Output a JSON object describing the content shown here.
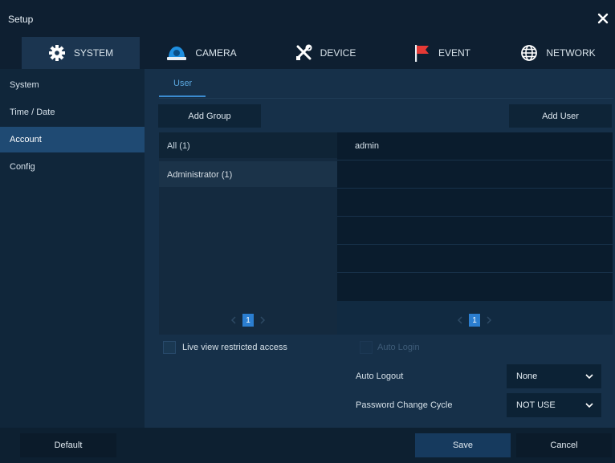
{
  "window": {
    "title": "Setup",
    "close_icon": "close-icon"
  },
  "tabs": [
    {
      "label": "SYSTEM",
      "icon": "gear-icon",
      "active": true
    },
    {
      "label": "CAMERA",
      "icon": "camera-icon",
      "active": false
    },
    {
      "label": "DEVICE",
      "icon": "tools-icon",
      "active": false
    },
    {
      "label": "EVENT",
      "icon": "flag-icon",
      "active": false
    },
    {
      "label": "NETWORK",
      "icon": "globe-icon",
      "active": false
    }
  ],
  "sidebar": {
    "items": [
      {
        "label": "System",
        "active": false
      },
      {
        "label": "Time / Date",
        "active": false
      },
      {
        "label": "Account",
        "active": true
      },
      {
        "label": "Config",
        "active": false
      }
    ]
  },
  "main": {
    "subtab": "User",
    "add_group": "Add Group",
    "add_user": "Add User",
    "groups": [
      "All (1)",
      "Administrator (1)"
    ],
    "users": [
      "admin",
      "",
      "",
      "",
      "",
      ""
    ],
    "group_page": "1",
    "user_page": "1",
    "live_view_label": "Live view restricted access",
    "auto_login_label": "Auto Login",
    "auto_logout_label": "Auto Logout",
    "auto_logout_value": "None",
    "password_cycle_label": "Password Change Cycle",
    "password_cycle_value": "NOT USE"
  },
  "footer": {
    "default": "Default",
    "save": "Save",
    "cancel": "Cancel"
  },
  "colors": {
    "accent": "#2b7ed0",
    "active_sidebar": "#1f4a73",
    "background": "#10263a",
    "flag": "#e53935"
  }
}
